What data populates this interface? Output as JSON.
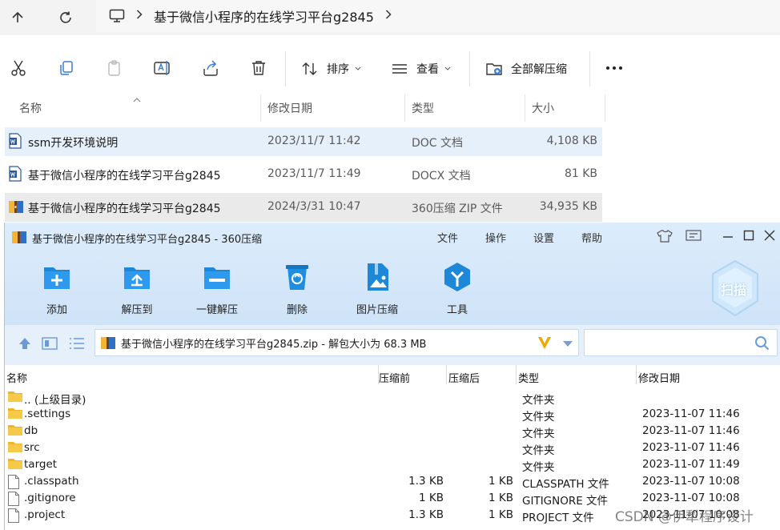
{
  "explorer": {
    "breadcrumb": [
      "基于微信小程序的在线学习平台g2845"
    ],
    "commands": {
      "sort": "排序",
      "view": "查看",
      "extract_all": "全部解压缩"
    },
    "columns": {
      "name": "名称",
      "modified": "修改日期",
      "type": "类型",
      "size": "大小"
    },
    "files": [
      {
        "name": "ssm开发环境说明",
        "modified": "2023/11/7 11:42",
        "type": "DOC 文档",
        "size": "4,108 KB",
        "icon": "word-doc-icon",
        "state": "selected"
      },
      {
        "name": "基于微信小程序的在线学习平台g2845",
        "modified": "2023/11/7 11:49",
        "type": "DOCX 文档",
        "size": "81 KB",
        "icon": "word-docx-icon",
        "state": ""
      },
      {
        "name": "基于微信小程序的在线学习平台g2845",
        "modified": "2024/3/31 10:47",
        "type": "360压缩 ZIP 文件",
        "size": "34,935 KB",
        "icon": "zip-archive-icon",
        "state": "hover"
      }
    ]
  },
  "zip": {
    "title": "基于微信小程序的在线学习平台g2845 - 360压缩",
    "menu": [
      "文件",
      "操作",
      "设置",
      "帮助"
    ],
    "tools": [
      {
        "label": "添加",
        "icon": "add-icon"
      },
      {
        "label": "解压到",
        "icon": "extract-to-icon"
      },
      {
        "label": "一键解压",
        "icon": "one-click-extract-icon"
      },
      {
        "label": "删除",
        "icon": "delete-icon"
      },
      {
        "label": "图片压缩",
        "icon": "image-compress-icon"
      },
      {
        "label": "工具",
        "icon": "tools-icon"
      }
    ],
    "scan_label": "扫描",
    "path": "基于微信小程序的在线学习平台g2845.zip - 解包大小为 68.3 MB",
    "columns": {
      "name": "名称",
      "before": "压缩前",
      "after": "压缩后",
      "type": "类型",
      "modified": "修改日期"
    },
    "entries": [
      {
        "name": ".. (上级目录)",
        "before": "",
        "after": "",
        "type": "文件夹",
        "modified": "",
        "icon": "folder-icon"
      },
      {
        "name": ".settings",
        "before": "",
        "after": "",
        "type": "文件夹",
        "modified": "2023-11-07 11:46",
        "icon": "folder-icon"
      },
      {
        "name": "db",
        "before": "",
        "after": "",
        "type": "文件夹",
        "modified": "2023-11-07 11:46",
        "icon": "folder-icon"
      },
      {
        "name": "src",
        "before": "",
        "after": "",
        "type": "文件夹",
        "modified": "2023-11-07 11:46",
        "icon": "folder-icon"
      },
      {
        "name": "target",
        "before": "",
        "after": "",
        "type": "文件夹",
        "modified": "2023-11-07 11:49",
        "icon": "folder-icon"
      },
      {
        "name": ".classpath",
        "before": "1.3 KB",
        "after": "1 KB",
        "type": "CLASSPATH 文件",
        "modified": "2023-11-07 10:08",
        "icon": "file-icon"
      },
      {
        "name": ".gitignore",
        "before": "1 KB",
        "after": "1 KB",
        "type": "GITIGNORE 文件",
        "modified": "2023-11-07 10:08",
        "icon": "file-icon"
      },
      {
        "name": ".project",
        "before": "1.3 KB",
        "after": "1 KB",
        "type": "PROJECT 文件",
        "modified": "2023-11-07 10:08",
        "icon": "file-icon"
      }
    ],
    "watermark": "CSDN @伊犁程序设计"
  }
}
